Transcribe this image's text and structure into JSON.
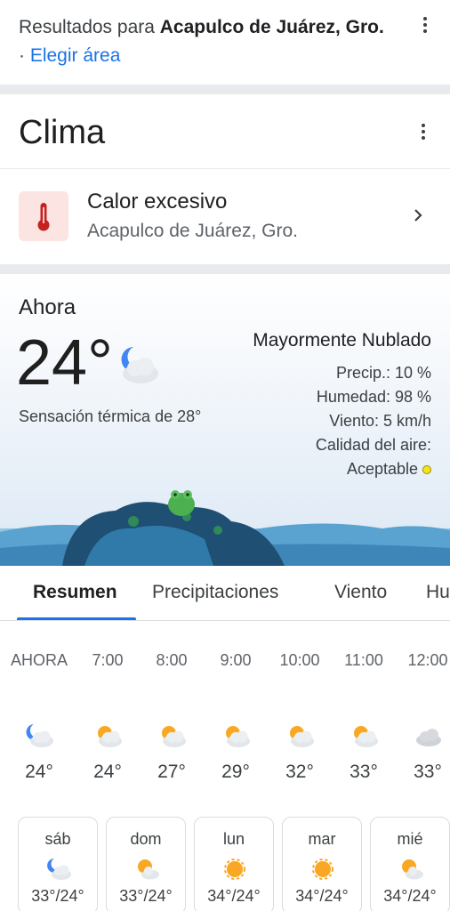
{
  "results": {
    "prefix": "Resultados para ",
    "location": "Acapulco de Juárez, Gro.",
    "separator": " · ",
    "change_area": "Elegir área"
  },
  "card": {
    "title": "Clima"
  },
  "alert": {
    "title": "Calor excesivo",
    "location": "Acapulco de Juárez, Gro.",
    "icon": "thermometer-icon",
    "color": "#c5221f"
  },
  "current": {
    "label": "Ahora",
    "temp": "24°",
    "feels_like": "Sensación térmica de 28°",
    "condition": "Mayormente Nublado",
    "precip": "Precip.: 10 %",
    "humidity": "Humedad: 98 %",
    "wind": "Viento: 5 km/h",
    "air_quality_label": "Calidad del aire:",
    "air_quality_value": "Aceptable",
    "icon": "night-partly-cloudy-icon"
  },
  "tabs": [
    "Resumen",
    "Precipitaciones",
    "Viento",
    "Hu"
  ],
  "hourly": [
    {
      "time": "AHORA",
      "temp": "24°",
      "icon": "night-partly-cloudy-icon"
    },
    {
      "time": "7:00",
      "temp": "24°",
      "icon": "partly-sunny-icon"
    },
    {
      "time": "8:00",
      "temp": "27°",
      "icon": "partly-sunny-icon"
    },
    {
      "time": "9:00",
      "temp": "29°",
      "icon": "partly-sunny-icon"
    },
    {
      "time": "10:00",
      "temp": "32°",
      "icon": "partly-sunny-icon"
    },
    {
      "time": "11:00",
      "temp": "33°",
      "icon": "partly-sunny-icon"
    },
    {
      "time": "12:00",
      "temp": "33°",
      "icon": "cloudy-icon"
    }
  ],
  "daily": [
    {
      "day": "sáb",
      "range": "33°/24°",
      "icon": "night-partly-cloudy-icon"
    },
    {
      "day": "dom",
      "range": "33°/24°",
      "icon": "partly-sunny-icon"
    },
    {
      "day": "lun",
      "range": "34°/24°",
      "icon": "sunny-icon"
    },
    {
      "day": "mar",
      "range": "34°/24°",
      "icon": "sunny-icon"
    },
    {
      "day": "mié",
      "range": "34°/24°",
      "icon": "partly-sunny-icon"
    }
  ],
  "colors": {
    "accent": "#1a73e8",
    "sun": "#f9a825",
    "moon": "#4285f4",
    "cloud": "#dfe3e8",
    "air_quality": "#f5e31a"
  }
}
